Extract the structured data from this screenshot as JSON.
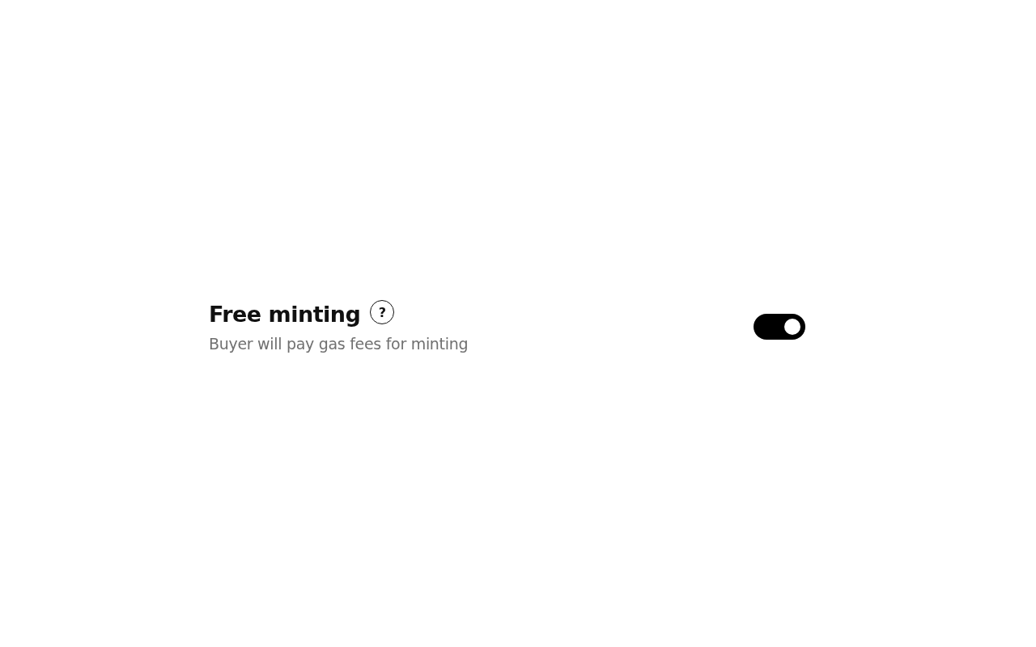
{
  "setting": {
    "title": "Free minting",
    "help": "?",
    "description": "Buyer will pay gas fees for minting",
    "on": true
  }
}
